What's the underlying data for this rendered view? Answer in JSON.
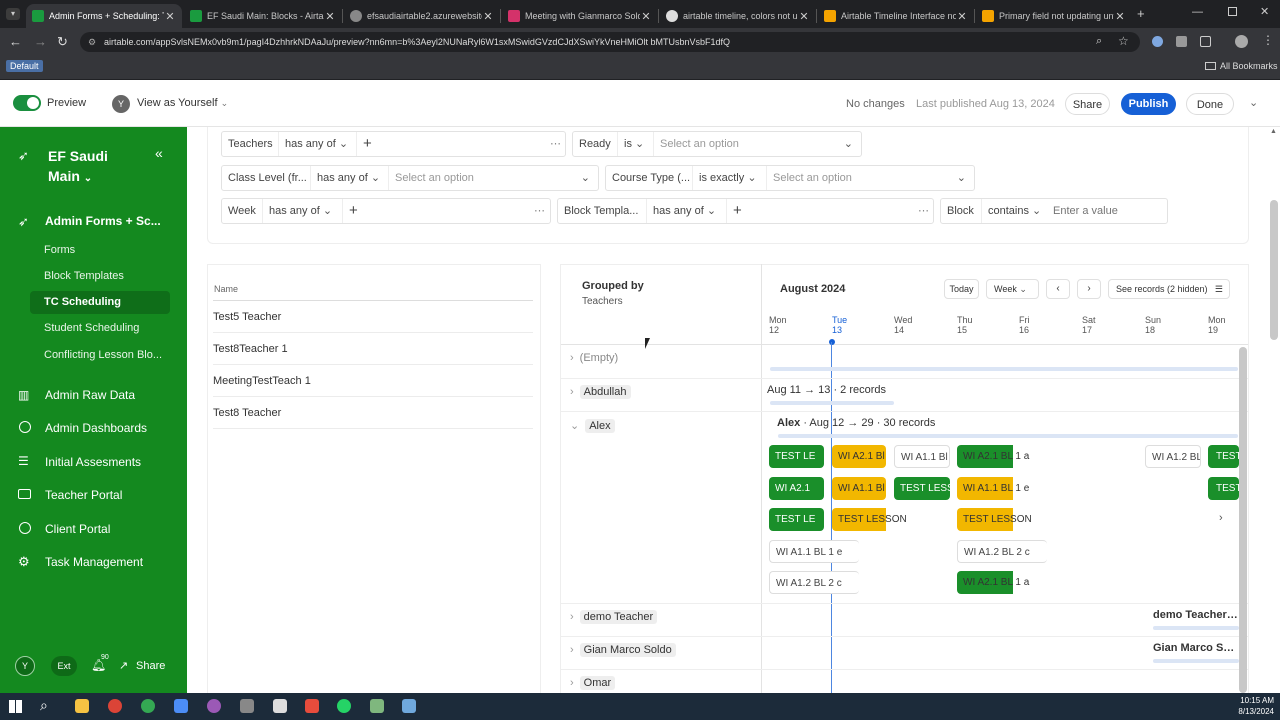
{
  "browser": {
    "tabs": [
      {
        "title": "Admin Forms + Scheduling: TC",
        "color": "#1a9b3f"
      },
      {
        "title": "EF Saudi Main: Blocks - Airtable",
        "color": "#1a9b3f"
      },
      {
        "title": "efsaudiairtable2.azurewebsites",
        "color": "#888888"
      },
      {
        "title": "Meeting with Gianmarco Soldo",
        "color": "#d4326a"
      },
      {
        "title": "airtable timeline, colors not up",
        "color": "#dddddd"
      },
      {
        "title": "Airtable Timeline Interface not",
        "color": "#f4a300"
      },
      {
        "title": "Primary field not updating unt",
        "color": "#f4a300"
      }
    ],
    "url": "airtable.com/appSvlsNEMx0vb9m1/pagI4DzhhrkNDAaJu/preview?nn6mn=b%3Aeyl2NUNaRyl6W1sxMSwidGVzdCJdXSwiYkVneHMiOlt bMTUsbnVsbF1dfQ",
    "profile_badge": "Default",
    "bookmarks": "All Bookmarks"
  },
  "header": {
    "preview": "Preview",
    "avatar": "Y",
    "view_as": "View as Yourself",
    "status": "No changes",
    "last_published": "Last published Aug 13, 2024",
    "share": "Share",
    "publish": "Publish",
    "done": "Done"
  },
  "sidebar": {
    "base_title_1": "EF Saudi",
    "base_title_2": "Main",
    "section": "Admin Forms + Sc...",
    "sub_items": [
      "Forms",
      "Block Templates",
      "TC Scheduling",
      "Student Scheduling",
      "Conflicting Lesson Blo..."
    ],
    "items": [
      "Admin Raw Data",
      "Admin Dashboards",
      "Initial Assesments",
      "Teacher Portal",
      "Client Portal",
      "Task Management"
    ],
    "footer": {
      "avatar": "Y",
      "ext": "Ext",
      "notif_count": "90",
      "share": "Share"
    }
  },
  "filters": {
    "teachers": {
      "label": "Teachers",
      "op": "has any of"
    },
    "ready": {
      "label": "Ready",
      "op": "is",
      "placeholder": "Select an option"
    },
    "class_level": {
      "label": "Class Level (fr...",
      "op": "has any of",
      "placeholder": "Select an option"
    },
    "course_type": {
      "label": "Course Type (...",
      "op": "is exactly",
      "placeholder": "Select an option"
    },
    "week": {
      "label": "Week",
      "op": "has any of"
    },
    "block_template": {
      "label": "Block Templa...",
      "op": "has any of"
    },
    "block": {
      "label": "Block",
      "op": "contains",
      "placeholder": "Enter a value"
    }
  },
  "list": {
    "header": "Name",
    "rows": [
      "Test5 Teacher",
      "Test8Teacher 1",
      "MeetingTestTeach 1",
      "Test8 Teacher"
    ]
  },
  "timeline": {
    "grouped_by_label": "Grouped by",
    "grouped_by_value": "Teachers",
    "month": "August 2024",
    "today": "Today",
    "range": "Week",
    "see_records": "See records (2 hidden)",
    "days": [
      {
        "dow": "Mon",
        "num": "12"
      },
      {
        "dow": "Tue",
        "num": "13"
      },
      {
        "dow": "Wed",
        "num": "14"
      },
      {
        "dow": "Thu",
        "num": "15"
      },
      {
        "dow": "Fri",
        "num": "16"
      },
      {
        "dow": "Sat",
        "num": "17"
      },
      {
        "dow": "Sun",
        "num": "18"
      },
      {
        "dow": "Mon",
        "num": "19"
      }
    ],
    "groups": [
      {
        "name": "(Empty)"
      },
      {
        "name": "Abdullah",
        "summary": "Aug 11 → 13 · 2 records"
      },
      {
        "name": "Alex",
        "summary_name": "Alex",
        "summary": "· Aug 12 → 29 · 30 records"
      },
      {
        "name": "demo Teacher",
        "summary": "demo Teacher · Au"
      },
      {
        "name": "Gian Marco Soldo",
        "summary": "Gian Marco Soldo"
      },
      {
        "name": "Omar"
      }
    ],
    "bars": [
      {
        "text": "TEST LE",
        "kind": "g"
      },
      {
        "text": "WI A2.1 Bl",
        "kind": "o"
      },
      {
        "text": "WI A1.1 Bl",
        "kind": "w"
      },
      {
        "text": "WI A2.1 BL 1 a",
        "kind": "g"
      },
      {
        "text": "WI A1.2 BL",
        "kind": "w"
      },
      {
        "text": "TEST",
        "kind": "g"
      },
      {
        "text": "WI A2.1",
        "kind": "g"
      },
      {
        "text": "WI A1.1 Bl",
        "kind": "o"
      },
      {
        "text": "TEST LESS",
        "kind": "g"
      },
      {
        "text": "WI A1.1 BL 1 e",
        "kind": "o"
      },
      {
        "text": "TEST",
        "kind": "g"
      },
      {
        "text": "TEST LE",
        "kind": "g"
      },
      {
        "text": "TEST LESSON",
        "kind": "o"
      },
      {
        "text": "TEST LESSON",
        "kind": "o"
      },
      {
        "text": "WI A1.1 BL 1 e",
        "kind": "w"
      },
      {
        "text": "WI A1.2 BL 2 c",
        "kind": "w"
      },
      {
        "text": "WI A1.2 BL 2 c",
        "kind": "w"
      },
      {
        "text": "WI A2.1 BL 1 a",
        "kind": "g"
      }
    ]
  },
  "taskbar": {
    "time": "10:15 AM",
    "date": "8/13/2024"
  }
}
